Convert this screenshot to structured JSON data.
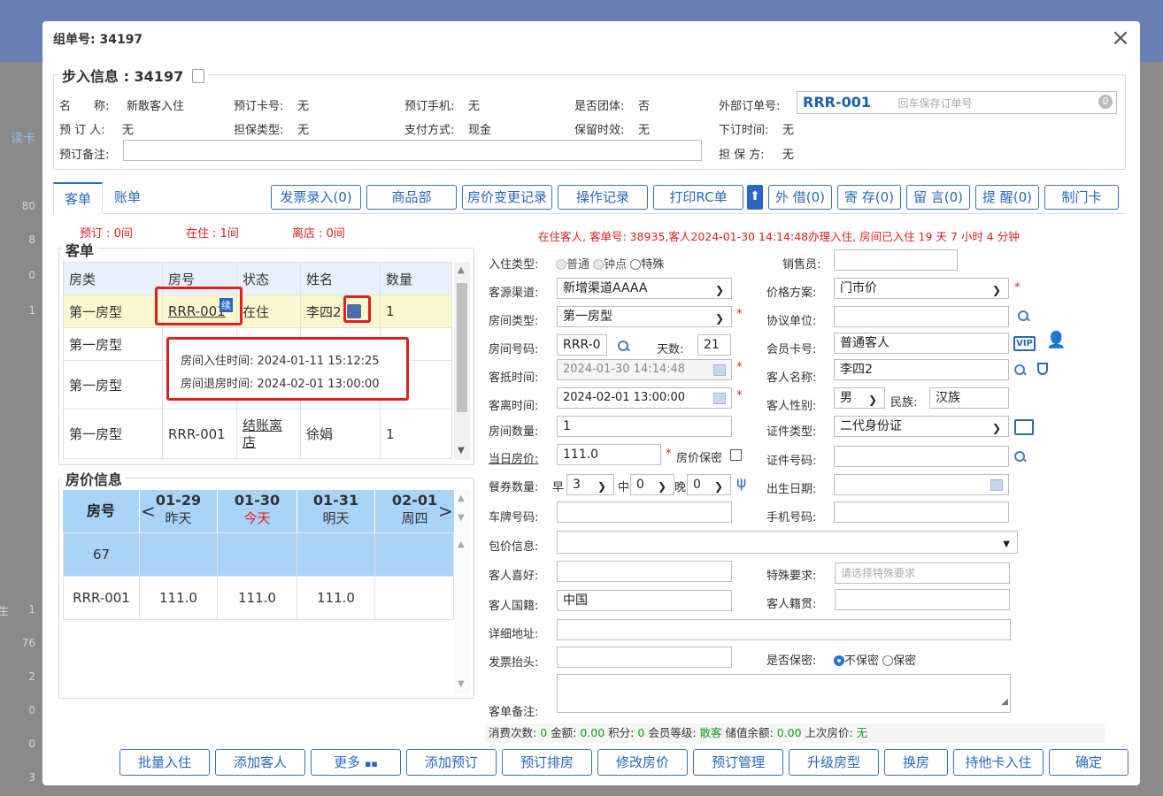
{
  "background": {
    "left_numbers": [
      "80",
      "8",
      "0",
      "1",
      "1",
      "76",
      "2",
      "0",
      "0",
      "3"
    ],
    "left_text": "读卡",
    "left_text2": "生"
  },
  "modal": {
    "title": "组单号: 34197",
    "close": "×"
  },
  "booking": {
    "legend": "步入信息 : 34197",
    "name_label": "名　　称:",
    "name_value": "新散客入住",
    "card_label": "预订卡号:",
    "card_value": "无",
    "phone_label": "预订手机:",
    "phone_value": "无",
    "group_label": "是否团体:",
    "group_value": "否",
    "ext_label": "外部订单号:",
    "ext_value": "RRR-001",
    "ext_placeholder": "回车保存订单号",
    "ext_badge": "0",
    "booker_label": "预 订 人:",
    "booker_value": "无",
    "guarantee_label": "担保类型:",
    "guarantee_value": "无",
    "pay_label": "支付方式:",
    "pay_value": "现金",
    "retain_label": "保留时效:",
    "retain_value": "无",
    "order_time_label": "下订时间:",
    "order_time_value": "无",
    "remark_label": "预订备注:",
    "guarantor_label": "担 保 方:",
    "guarantor_value": "无"
  },
  "tabs": [
    "客单",
    "账单"
  ],
  "toolbar": [
    "发票录入(0)",
    "商品部",
    "房价变更记录",
    "操作记录",
    "打印RC单",
    "外 借(0)",
    "寄 存(0)",
    "留 言(0)",
    "提 醒(0)",
    "制门卡"
  ],
  "stats": {
    "reserve": "预订 : 0间",
    "in": "在住 : 1间",
    "out": "离店 : 0间"
  },
  "notice": "在住客人, 客单号: 38935,客人2024-01-30 14:14:48办理入住, 房间已入住 19 天 7 小时 4 分钟",
  "orders": {
    "legend": "客单",
    "headers": [
      "房类",
      "房号",
      "状态",
      "姓名",
      "数量"
    ],
    "rows": [
      {
        "type": "第一房型",
        "room": "RRR-001",
        "badge": "续",
        "status": "在住",
        "name": "李四2",
        "qty": "1"
      },
      {
        "type": "第一房型",
        "room": "",
        "status": "",
        "name": "",
        "qty": ""
      },
      {
        "type": "第一房型",
        "room": "",
        "status": "",
        "name": "",
        "qty": ""
      },
      {
        "type": "第一房型",
        "room": "RRR-001",
        "status": "结账离店",
        "name": "徐娟",
        "qty": "1"
      }
    ],
    "tooltip": {
      "checkin": "房间入住时间: 2024-01-11 15:12:25",
      "checkout": "房间退房时间: 2024-02-01 13:00:00"
    }
  },
  "prices": {
    "legend": "房价信息",
    "room_header": "房号",
    "days": [
      {
        "date": "01-29",
        "label": "昨天"
      },
      {
        "date": "01-30",
        "label": "今天"
      },
      {
        "date": "01-31",
        "label": "明天"
      },
      {
        "date": "02-01",
        "label": "周四"
      }
    ],
    "rows": [
      {
        "room": "67",
        "values": [
          "",
          "",
          "",
          ""
        ]
      },
      {
        "room": "RRR-001",
        "values": [
          "111.0",
          "111.0",
          "111.0",
          ""
        ]
      }
    ]
  },
  "form": {
    "checkin_type_label": "入住类型:",
    "types": [
      "普通",
      "钟点",
      "特殊"
    ],
    "seller_label": "销售员:",
    "channel_label": "客源渠道:",
    "channel_value": "新增渠道AAAA",
    "price_plan_label": "价格方案:",
    "price_plan_value": "门市价",
    "roomtype_label": "房间类型:",
    "roomtype_value": "第一房型",
    "agreement_label": "协议单位:",
    "roomno_label": "房间号码:",
    "roomno_value": "RRR-0",
    "days_label": "天数:",
    "days_value": "21",
    "member_label": "会员卡号:",
    "member_value": "普通客人",
    "arrive_label": "客抵时间:",
    "arrive_value": "2024-01-30 14:14:48",
    "guest_label": "客人名称:",
    "guest_value": "李四2",
    "leave_label": "客离时间:",
    "leave_value": "2024-02-01 13:00:00",
    "gender_label": "客人性别:",
    "gender_value": "男",
    "ethnic_label": "民族:",
    "ethnic_value": "汉族",
    "count_label": "房间数量:",
    "count_value": "1",
    "idtype_label": "证件类型:",
    "idtype_value": "二代身份证",
    "dayprice_label": "当日房价:",
    "dayprice_value": "111.0",
    "secret_price_label": "房价保密",
    "idno_label": "证件号码:",
    "meal_label": "餐券数量:",
    "meal_b": "早",
    "meal_b_value": "3",
    "meal_l": "中",
    "meal_l_value": "0",
    "meal_d": "晚",
    "meal_d_value": "0",
    "birth_label": "出生日期:",
    "plate_label": "车牌号码:",
    "mobile_label": "手机号码:",
    "package_label": "包价信息:",
    "pref_label": "客人喜好:",
    "special_label": "特殊要求:",
    "special_placeholder": "请选择特殊要求",
    "nation_label": "客人国籍:",
    "nation_value": "中国",
    "native_label": "客人籍贯:",
    "address_label": "详细地址:",
    "invoice_label": "发票抬头:",
    "secret_label": "是否保密:",
    "secret_opts": [
      "不保密",
      "保密"
    ],
    "remark_label": "客单备注:"
  },
  "summary": {
    "a": "消费次数:",
    "a_v": "0",
    "b": "金额:",
    "b_v": "0.00",
    "c": "积分:",
    "c_v": "0",
    "d": "会员等级:",
    "d_v": "散客",
    "e": "储值余额:",
    "e_v": "0.00",
    "f": "上次房价:",
    "f_v": "无"
  },
  "footer": [
    "批量入住",
    "添加客人",
    "更多",
    "添加预订",
    "预订排房",
    "修改房价",
    "预订管理",
    "升级房型",
    "换房",
    "持他卡入住",
    "确定"
  ],
  "colors": {
    "accent": "#2a66c2",
    "header_blue": "#a9d3f7",
    "highlight_row": "#fbf8d0",
    "red": "#e02020",
    "green": "#1a9a1a"
  }
}
